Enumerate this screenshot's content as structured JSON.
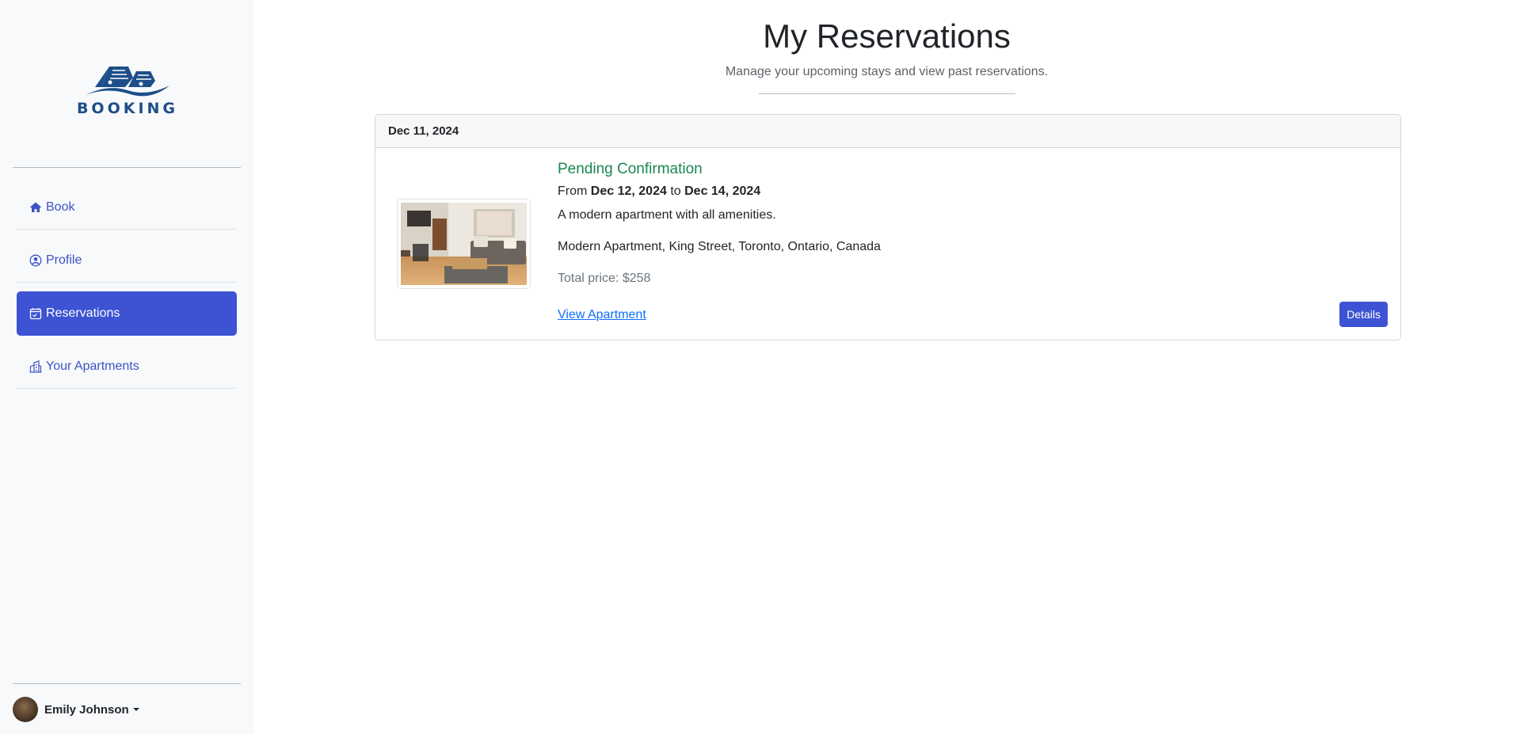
{
  "brand": {
    "name": "BOOKING",
    "logo_icon": "houses-on-wave-logo",
    "color": "#1d4e89"
  },
  "sidebar": {
    "items": [
      {
        "label": "Book",
        "icon": "house-icon",
        "active": false
      },
      {
        "label": "Profile",
        "icon": "person-circle-icon",
        "active": false
      },
      {
        "label": "Reservations",
        "icon": "calendar-check-icon",
        "active": true
      },
      {
        "label": "Your Apartments",
        "icon": "buildings-icon",
        "active": false
      }
    ],
    "active_color": "#3d53d3",
    "user": {
      "name": "Emily Johnson"
    }
  },
  "page": {
    "title": "My Reservations",
    "subtitle": "Manage your upcoming stays and view past reservations."
  },
  "reservations": [
    {
      "booked_date": "Dec 11, 2024",
      "status": "Pending Confirmation",
      "status_color": "#198754",
      "dates_from_label": "From",
      "start_date": "Dec 12, 2024",
      "dates_to_label": "to",
      "end_date": "Dec 14, 2024",
      "description": "A modern apartment with all amenities.",
      "address": "Modern Apartment, King Street, Toronto, Ontario, Canada",
      "total_price": "Total price: $258",
      "view_link_label": "View Apartment",
      "details_label": "Details"
    }
  ]
}
